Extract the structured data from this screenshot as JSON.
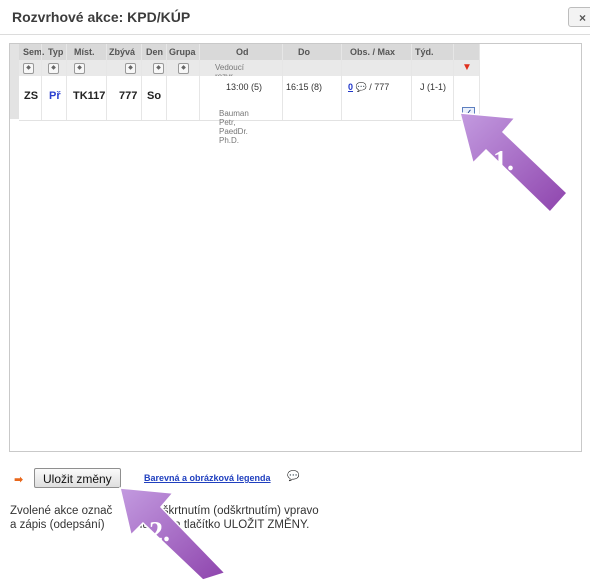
{
  "window": {
    "title": "Rozvrhové akce: KPD/KÚP",
    "close_label": "×"
  },
  "table": {
    "headers": [
      "Sem.",
      "Typ",
      "Míst.",
      "Zbývá",
      "Den",
      "Grupa",
      "Od",
      "Do",
      "Obs. / Max",
      "Týd."
    ],
    "subheader": "Vedoucí rozvr. akce. - kontakt",
    "row": {
      "sem": "ZS",
      "typ": "Př",
      "mist": "TK117",
      "zbyva": "777",
      "den": "So",
      "grupa": "",
      "od": "13:00 (5)",
      "do": "16:15 (8)",
      "obs": "0",
      "max": "/ 777",
      "tyd": "J (1-1)",
      "teacher": "Bauman Petr, PaedDr. Ph.D.",
      "checked": true
    }
  },
  "actions": {
    "save_label": "Uložit změny",
    "legend_label": "Barevná a obrázková legenda"
  },
  "instructions": {
    "line1": "Zvolené akce označ     čte) zaškrtnutím (odškrtnutím) vpravo",
    "line2": "a zápis (odepsání)        knutím na tlačítko ULOŽIT ZMĚNY."
  },
  "callouts": [
    {
      "label": "1.",
      "color": "#9b59b6"
    },
    {
      "label": "2.",
      "color": "#9b59b6"
    }
  ],
  "colors": {
    "accent_red": "#e0301e",
    "link_blue": "#1f35c9",
    "callout_purple": "#9b59b6"
  }
}
